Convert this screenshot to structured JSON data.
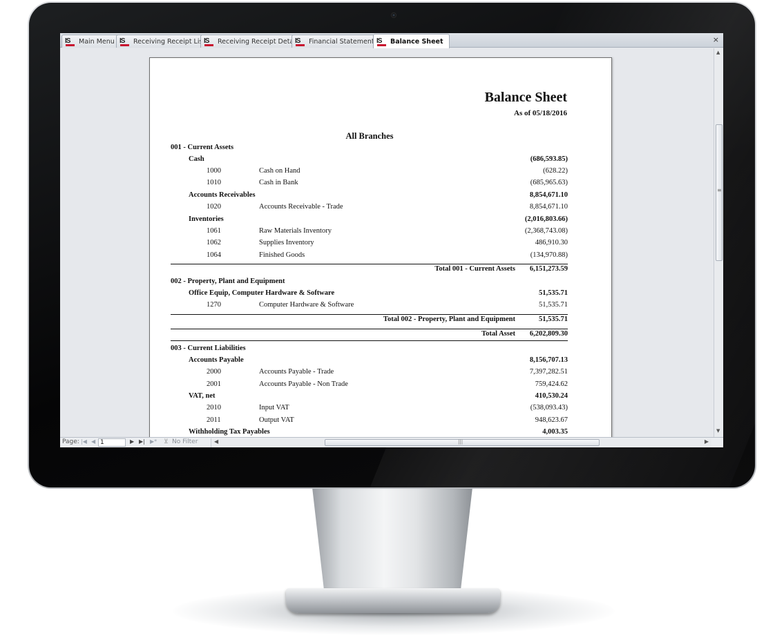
{
  "tabs": [
    {
      "label": "Main Menu"
    },
    {
      "label": "Receiving Receipt List"
    },
    {
      "label": "Receiving Receipt Detail"
    },
    {
      "label": "Financial Statements"
    },
    {
      "label": "Balance Sheet"
    }
  ],
  "tab_icon_text": "IS",
  "close_glyph": "×",
  "report": {
    "title": "Balance Sheet",
    "as_of": "As of 05/18/2016",
    "branch": "All Branches",
    "sections": {
      "current_assets": {
        "heading": "001 - Current Assets",
        "cash": {
          "label": "Cash",
          "amount": "(686,593.85)",
          "rows": [
            {
              "code": "1000",
              "name": "Cash on Hand",
              "amount": "(628.22)"
            },
            {
              "code": "1010",
              "name": "Cash in Bank",
              "amount": "(685,965.63)"
            }
          ]
        },
        "ar": {
          "label": "Accounts Receivables",
          "amount": "8,854,671.10",
          "rows": [
            {
              "code": "1020",
              "name": "Accounts Receivable - Trade",
              "amount": "8,854,671.10"
            }
          ]
        },
        "inv": {
          "label": "Inventories",
          "amount": "(2,016,803.66)",
          "rows": [
            {
              "code": "1061",
              "name": "Raw Materials Inventory",
              "amount": "(2,368,743.08)"
            },
            {
              "code": "1062",
              "name": "Supplies Inventory",
              "amount": "486,910.30"
            },
            {
              "code": "1064",
              "name": "Finished Goods",
              "amount": "(134,970.88)"
            }
          ]
        },
        "total_label": "Total 001 - Current Assets",
        "total_amount": "6,151,273.59"
      },
      "ppe": {
        "heading": "002 - Property, Plant and Equipment",
        "office": {
          "label": "Office Equip, Computer Hardware & Software",
          "amount": "51,535.71",
          "rows": [
            {
              "code": "1270",
              "name": "Computer Hardware & Software",
              "amount": "51,535.71"
            }
          ]
        },
        "total_label": "Total 002 - Property, Plant and Equipment",
        "total_amount": "51,535.71"
      },
      "total_asset": {
        "label": "Total Asset",
        "amount": "6,202,809.30"
      },
      "current_liabilities": {
        "heading": "003 - Current Liabilities",
        "ap": {
          "label": "Accounts Payable",
          "amount": "8,156,707.13",
          "rows": [
            {
              "code": "2000",
              "name": "Accounts Payable - Trade",
              "amount": "7,397,282.51"
            },
            {
              "code": "2001",
              "name": "Accounts Payable - Non Trade",
              "amount": "759,424.62"
            }
          ]
        },
        "vat": {
          "label": "VAT, net",
          "amount": "410,530.24",
          "rows": [
            {
              "code": "2010",
              "name": "Input VAT",
              "amount": "(538,093.43)"
            },
            {
              "code": "2011",
              "name": "Output VAT",
              "amount": "948,623.67"
            }
          ]
        },
        "wht": {
          "label": "Withholding Tax Payables",
          "amount": "4,003.35"
        }
      }
    }
  },
  "statusbar": {
    "page_label": "Page:",
    "page_value": "1",
    "filter_label": "No Filter",
    "nav_first": "|◀",
    "nav_prev": "◀",
    "nav_next": "▶",
    "nav_last": "▶|",
    "nav_new": "▶*",
    "filter_icon": "⊻"
  },
  "scroll_arrows": {
    "up": "▲",
    "down": "▼",
    "left": "◀",
    "right": "▶",
    "grip_v": "≡",
    "grip_h": "|||"
  }
}
